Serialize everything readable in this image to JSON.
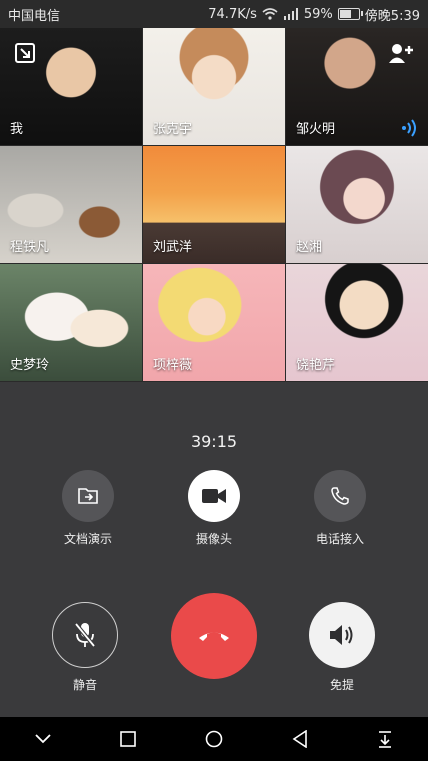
{
  "status_bar": {
    "carrier": "中国电信",
    "net_speed": "74.7K/s",
    "battery": "59%",
    "time": "傍晚5:39"
  },
  "participants": [
    {
      "name": "我"
    },
    {
      "name": "张克宇"
    },
    {
      "name": "邹火明"
    },
    {
      "name": "程铁凡"
    },
    {
      "name": "刘武洋"
    },
    {
      "name": "赵湘"
    },
    {
      "name": "史梦玲"
    },
    {
      "name": "项梓薇"
    },
    {
      "name": "饶艳芹"
    }
  ],
  "call": {
    "duration": "39:15"
  },
  "controls": {
    "share_doc": "文档演示",
    "camera": "摄像头",
    "phone_dial_in": "电话接入",
    "mute": "静音",
    "speaker": "免提"
  },
  "colors": {
    "background": "#3a3a3c",
    "hangup": "#ea4a4a"
  }
}
